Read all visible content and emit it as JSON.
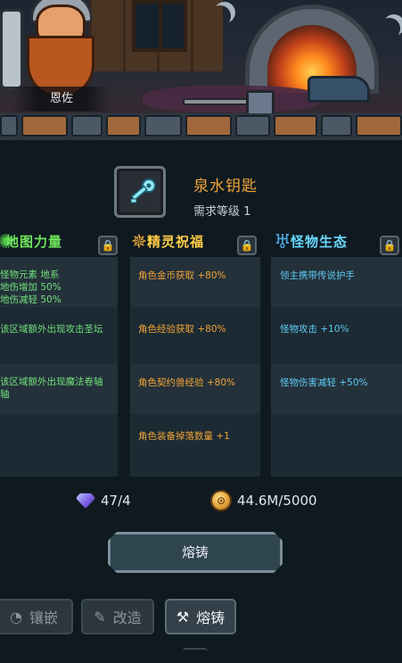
{
  "npc": {
    "name": "恩佐"
  },
  "item": {
    "name": "泉水钥匙",
    "requirement": "需求等级 1",
    "icon": "key-icon"
  },
  "columns": [
    {
      "title": "地图力量",
      "icon": "map-emblem-icon",
      "locked": true,
      "effects": [
        {
          "lines": [
            "怪物元素 地系",
            "地伤增加 50%",
            "地伤减轻 50%"
          ]
        },
        {
          "lines": [
            "该区域额外出现攻击圣坛"
          ]
        },
        {
          "lines": [
            "该区域额外出现魔法卷轴",
            "轴"
          ]
        }
      ]
    },
    {
      "title": "精灵祝福",
      "icon": "spirit-emblem-icon",
      "locked": true,
      "effects": [
        {
          "lines": [
            "角色金币获取 +80%"
          ]
        },
        {
          "lines": [
            "角色经验获取 +80%"
          ]
        },
        {
          "lines": [
            "角色契约兽经验 +80%"
          ]
        },
        {
          "lines": [
            "角色装备掉落数量 +1"
          ]
        }
      ]
    },
    {
      "title": "怪物生态",
      "icon": "demon-emblem-icon",
      "locked": true,
      "effects": [
        {
          "lines": [
            "领主携带传说护手"
          ]
        },
        {
          "lines": [
            "怪物攻击 +10%"
          ]
        },
        {
          "lines": [
            "怪物伤害减轻 +50%"
          ]
        }
      ]
    }
  ],
  "resources": {
    "gem": {
      "value": "47/4",
      "icon": "crystal-icon"
    },
    "gold": {
      "value": "44.6M/5000",
      "icon": "gold-coin-icon"
    }
  },
  "cast_button": {
    "label": "熔铸"
  },
  "tabs": [
    {
      "label": "镶嵌",
      "icon": "inlay-icon",
      "active": false
    },
    {
      "label": "改造",
      "icon": "reforge-icon",
      "active": false
    },
    {
      "label": "熔铸",
      "icon": "cast-icon",
      "active": true
    }
  ],
  "colors": {
    "orange": "#f0a436",
    "green": "#72e07c",
    "blue": "#5fcbf5",
    "panel": "#1c2a33"
  }
}
